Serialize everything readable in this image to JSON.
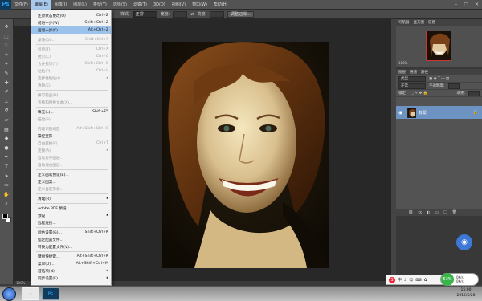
{
  "app": {
    "logo": "Ps"
  },
  "menubar": {
    "items": [
      "文件(F)",
      "编辑(E)",
      "图像(I)",
      "图层(L)",
      "类型(Y)",
      "选择(S)",
      "滤镜(T)",
      "3D(D)",
      "视图(V)",
      "窗口(W)",
      "帮助(H)"
    ],
    "active": 1,
    "window_controls": [
      "–",
      "□",
      "✕"
    ]
  },
  "options_bar": {
    "style_label": "样式:",
    "style_value": "正常",
    "width_label": "宽度:",
    "height_label": "高度:",
    "refine_button": "调整边缘..."
  },
  "edit_menu": [
    {
      "label": "还原状态更改(O)",
      "shortcut": "Ctrl+Z",
      "enabled": true
    },
    {
      "label": "前进一步(W)",
      "shortcut": "Shift+Ctrl+Z",
      "enabled": true
    },
    {
      "label": "后退一步(K)",
      "shortcut": "Alt+Ctrl+Z",
      "enabled": true,
      "highlighted": true
    },
    {
      "sep": true
    },
    {
      "label": "渐隐(D)...",
      "shortcut": "Shift+Ctrl+F",
      "enabled": false
    },
    {
      "sep": true
    },
    {
      "label": "剪切(T)",
      "shortcut": "Ctrl+X",
      "enabled": false
    },
    {
      "label": "拷贝(C)",
      "shortcut": "Ctrl+C",
      "enabled": false
    },
    {
      "label": "合并拷贝(Y)",
      "shortcut": "Shift+Ctrl+C",
      "enabled": false
    },
    {
      "label": "粘贴(P)",
      "shortcut": "Ctrl+V",
      "enabled": false
    },
    {
      "label": "选择性粘贴(I)",
      "submenu": true,
      "enabled": false
    },
    {
      "label": "清除(E)",
      "enabled": false
    },
    {
      "sep": true
    },
    {
      "label": "拼写检查(H)...",
      "enabled": false
    },
    {
      "label": "查找和替换文本(X)...",
      "enabled": false
    },
    {
      "sep": true
    },
    {
      "label": "填充(L)...",
      "shortcut": "Shift+F5",
      "enabled": true
    },
    {
      "label": "描边(S)...",
      "enabled": false
    },
    {
      "sep": true
    },
    {
      "label": "内容识别缩放",
      "shortcut": "Alt+Shift+Ctrl+C",
      "enabled": false
    },
    {
      "label": "操控变形",
      "enabled": true
    },
    {
      "label": "自由变换(F)",
      "shortcut": "Ctrl+T",
      "enabled": false
    },
    {
      "label": "变换(A)",
      "submenu": true,
      "enabled": false
    },
    {
      "label": "自动对齐图层...",
      "enabled": false
    },
    {
      "label": "自动混合图层...",
      "enabled": false
    },
    {
      "sep": true
    },
    {
      "label": "定义画笔预设(B)...",
      "enabled": true
    },
    {
      "label": "定义图案...",
      "enabled": true
    },
    {
      "label": "定义自定形状...",
      "enabled": false
    },
    {
      "sep": true
    },
    {
      "label": "清理(R)",
      "submenu": true,
      "enabled": true
    },
    {
      "sep": true
    },
    {
      "label": "Adobe PDF 预设...",
      "enabled": true
    },
    {
      "label": "预设",
      "submenu": true,
      "enabled": true
    },
    {
      "label": "远程连接...",
      "enabled": true
    },
    {
      "sep": true
    },
    {
      "label": "颜色设置(G)...",
      "shortcut": "Shift+Ctrl+K",
      "enabled": true
    },
    {
      "label": "指定配置文件...",
      "enabled": true
    },
    {
      "label": "转换为配置文件(V)...",
      "enabled": true
    },
    {
      "sep": true
    },
    {
      "label": "键盘快捷键...",
      "shortcut": "Alt+Shift+Ctrl+K",
      "enabled": true
    },
    {
      "label": "菜单(U)...",
      "shortcut": "Alt+Shift+Ctrl+M",
      "enabled": true
    },
    {
      "label": "首选项(N)",
      "submenu": true,
      "enabled": true
    },
    {
      "label": "同步设置(E)",
      "submenu": true,
      "enabled": true
    }
  ],
  "status": {
    "zoom": "100%"
  },
  "navigator": {
    "tabs": [
      "导航器",
      "直方图",
      "信息"
    ],
    "zoom": "100%"
  },
  "layers": {
    "tabs": [
      "图层",
      "通道",
      "路径"
    ],
    "filter_value": "类型",
    "blend_value": "正常",
    "opacity_label": "不透明度:",
    "lock_label": "锁定:",
    "fill_label": "填充:",
    "layer_name": "背景",
    "bottom_icons": [
      "⛓",
      "fx",
      "◐",
      "▭",
      "❏",
      "🗑"
    ]
  },
  "tray": {
    "ime": "S",
    "items": [
      "中",
      "♪",
      "☺",
      "⌨",
      "✿"
    ]
  },
  "netspeed": {
    "percent": "53%",
    "up": "0K/s",
    "down": "0K/s"
  },
  "clock": {
    "time": "15:00",
    "date": "2015/5/28"
  },
  "colors": {
    "highlight": "#9bc2eb",
    "layer_selected": "#6d93c2",
    "panel": "#535353"
  }
}
